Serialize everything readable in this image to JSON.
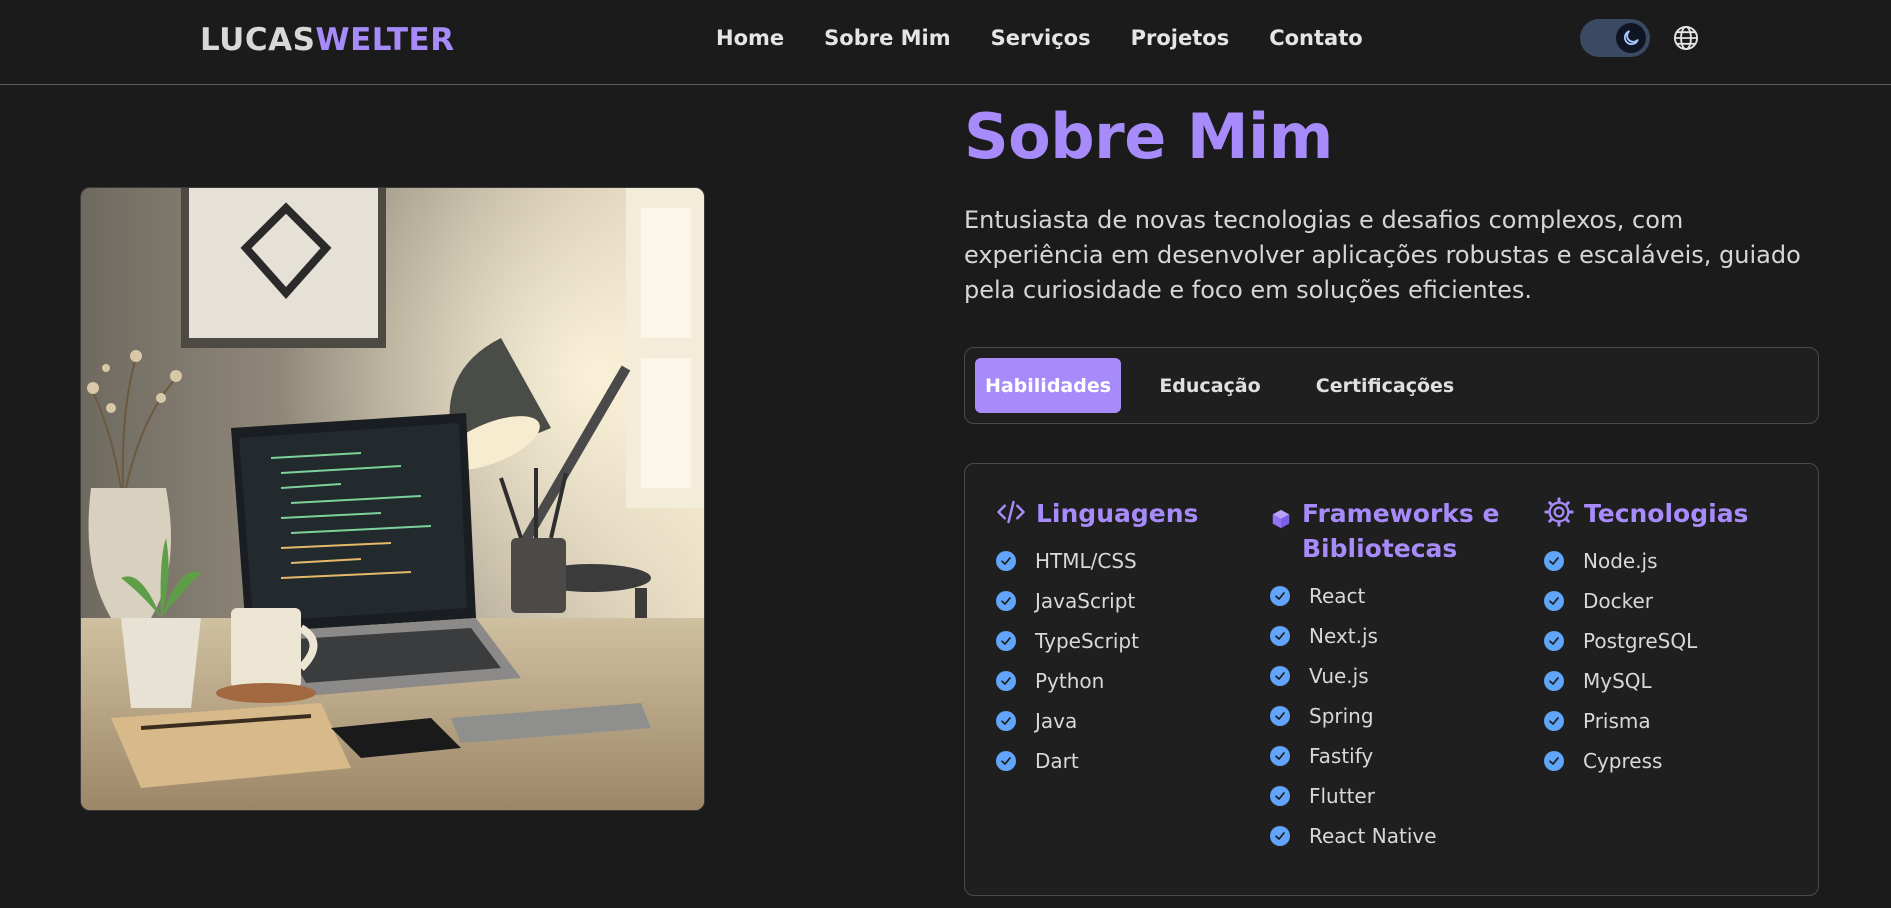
{
  "header": {
    "logo_first": "LUCAS",
    "logo_second": "WELTER",
    "nav": [
      "Home",
      "Sobre Mim",
      "Serviços",
      "Projetos",
      "Contato"
    ],
    "theme": "dark"
  },
  "about": {
    "title": "Sobre Mim",
    "description": "Entusiasta de novas tecnologias e desafios complexos, com experiência em desenvolver aplicações robustas e escaláveis, guiado pela curiosidade e foco em soluções eficientes.",
    "tabs": [
      "Habilidades",
      "Educação",
      "Certificações"
    ],
    "active_tab": "Habilidades"
  },
  "skills": {
    "languages": {
      "icon": "code-icon",
      "title": "Linguagens",
      "items": [
        "HTML/CSS",
        "JavaScript",
        "TypeScript",
        "Python",
        "Java",
        "Dart"
      ]
    },
    "frameworks": {
      "icon": "cube-icon",
      "title": "Frameworks e Bibliotecas",
      "items": [
        "React",
        "Next.js",
        "Vue.js",
        "Spring",
        "Fastify",
        "Flutter",
        "React Native"
      ]
    },
    "technologies": {
      "icon": "cog-icon",
      "title": "Tecnologias",
      "items": [
        "Node.js",
        "Docker",
        "PostgreSQL",
        "MySQL",
        "Prisma",
        "Cypress"
      ]
    }
  },
  "colors": {
    "accent": "#a78bfa",
    "check": "#60a5fa",
    "background": "#1b1b1b"
  }
}
